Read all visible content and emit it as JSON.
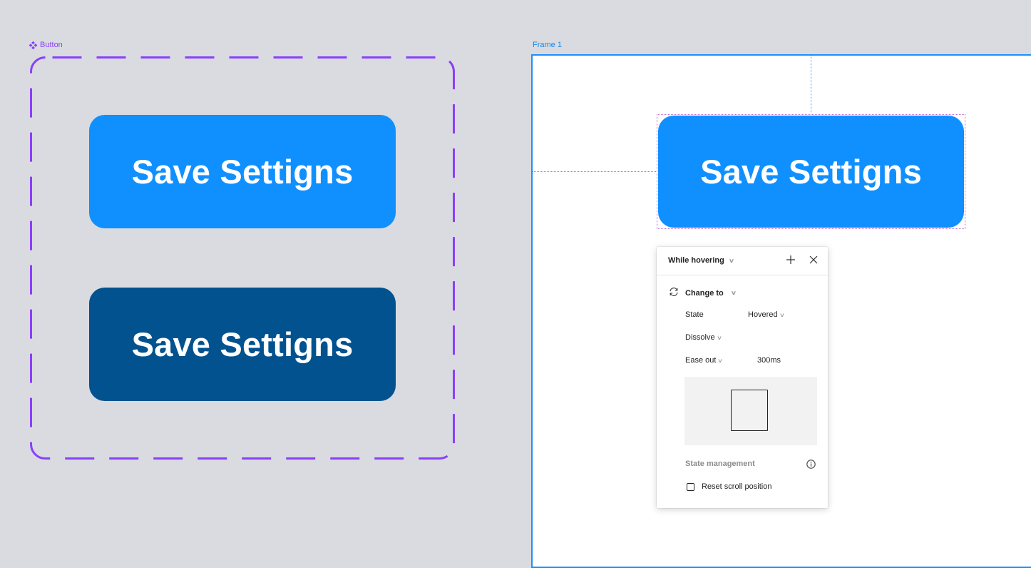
{
  "canvas": {
    "background": "#d9dbe0"
  },
  "component_set": {
    "label": "Button",
    "icon": "component-diamond-icon",
    "border_color": "#8a3ffc",
    "variants": [
      {
        "name": "default",
        "label": "Save Settigns",
        "color": "#1090ff"
      },
      {
        "name": "hovered",
        "label": "Save Settigns",
        "color": "#02528f"
      }
    ]
  },
  "frame": {
    "label": "Frame 1",
    "border_color": "#1a90ff",
    "instance": {
      "label": "Save Settigns",
      "color": "#1090ff"
    }
  },
  "interaction_panel": {
    "trigger": "While hovering",
    "add_icon": "plus-icon",
    "close_icon": "close-icon",
    "action": {
      "icon": "swap-icon",
      "label": "Change to"
    },
    "state_label": "State",
    "state_value": "Hovered",
    "animation": "Dissolve",
    "easing": "Ease out",
    "duration": "300ms",
    "state_management_label": "State management",
    "info_icon": "info-icon",
    "reset_scroll_label": "Reset scroll position",
    "reset_scroll_checked": false
  }
}
